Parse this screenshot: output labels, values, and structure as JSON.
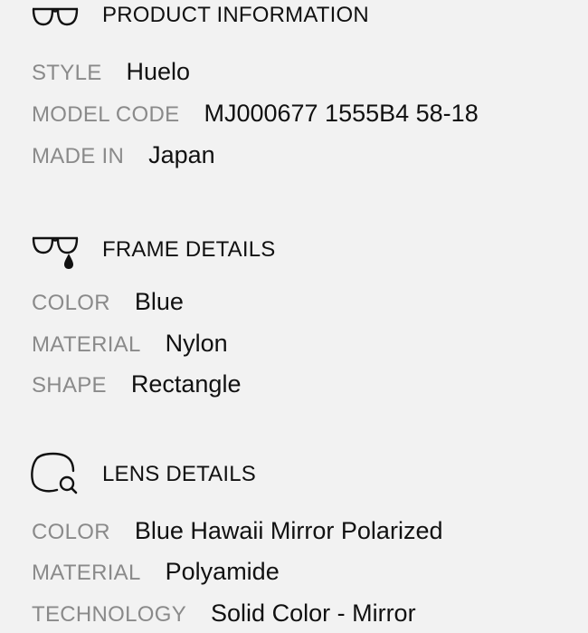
{
  "product_information": {
    "icon": "sunglasses-icon",
    "title": "PRODUCT INFORMATION",
    "rows": [
      {
        "label": "STYLE",
        "value": "Huelo"
      },
      {
        "label": "MODEL CODE",
        "value": "MJ000677 1555B4 58-18"
      },
      {
        "label": "MADE IN",
        "value": "Japan"
      }
    ]
  },
  "frame_details": {
    "icon": "frame-color-drop-icon",
    "title": "FRAME DETAILS",
    "rows": [
      {
        "label": "COLOR",
        "value": "Blue"
      },
      {
        "label": "MATERIAL",
        "value": "Nylon"
      },
      {
        "label": "SHAPE",
        "value": "Rectangle"
      }
    ]
  },
  "lens_details": {
    "icon": "lens-magnifier-icon",
    "title": "LENS DETAILS",
    "rows": [
      {
        "label": "COLOR",
        "value": "Blue Hawaii Mirror Polarized"
      },
      {
        "label": "MATERIAL",
        "value": "Polyamide"
      },
      {
        "label": "TECHNOLOGY",
        "value": "Solid Color - Mirror"
      }
    ]
  },
  "colors": {
    "background": "#f2f2f2",
    "label": "#8a8a8a",
    "text": "#111111"
  }
}
